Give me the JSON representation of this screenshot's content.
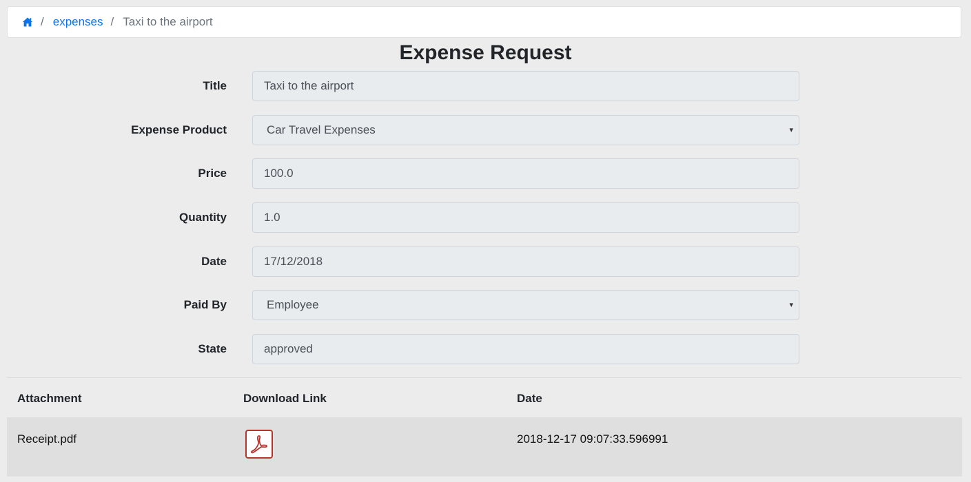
{
  "breadcrumb": {
    "home_icon": "home-icon",
    "separator": "/",
    "link": "expenses",
    "current": "Taxi to the airport"
  },
  "page": {
    "title": "Expense Request"
  },
  "form": {
    "title": {
      "label": "Title",
      "value": "Taxi to the airport"
    },
    "expense_product": {
      "label": "Expense Product",
      "value": "Car Travel Expenses"
    },
    "price": {
      "label": "Price",
      "value": "100.0"
    },
    "quantity": {
      "label": "Quantity",
      "value": "1.0"
    },
    "date": {
      "label": "Date",
      "value": "17/12/2018"
    },
    "paid_by": {
      "label": "Paid By",
      "value": "Employee"
    },
    "state": {
      "label": "State",
      "value": "approved"
    },
    "select_caret": "▾"
  },
  "attachments": {
    "headers": {
      "attachment": "Attachment",
      "download": "Download Link",
      "date": "Date"
    },
    "rows": [
      {
        "name": "Receipt.pdf",
        "icon": "pdf-icon",
        "date": "2018-12-17 09:07:33.596991"
      }
    ]
  },
  "colors": {
    "link": "#0b74e8",
    "pdf_icon": "#b3352d",
    "field_bg": "#e9ecef",
    "page_bg": "#ececec"
  }
}
